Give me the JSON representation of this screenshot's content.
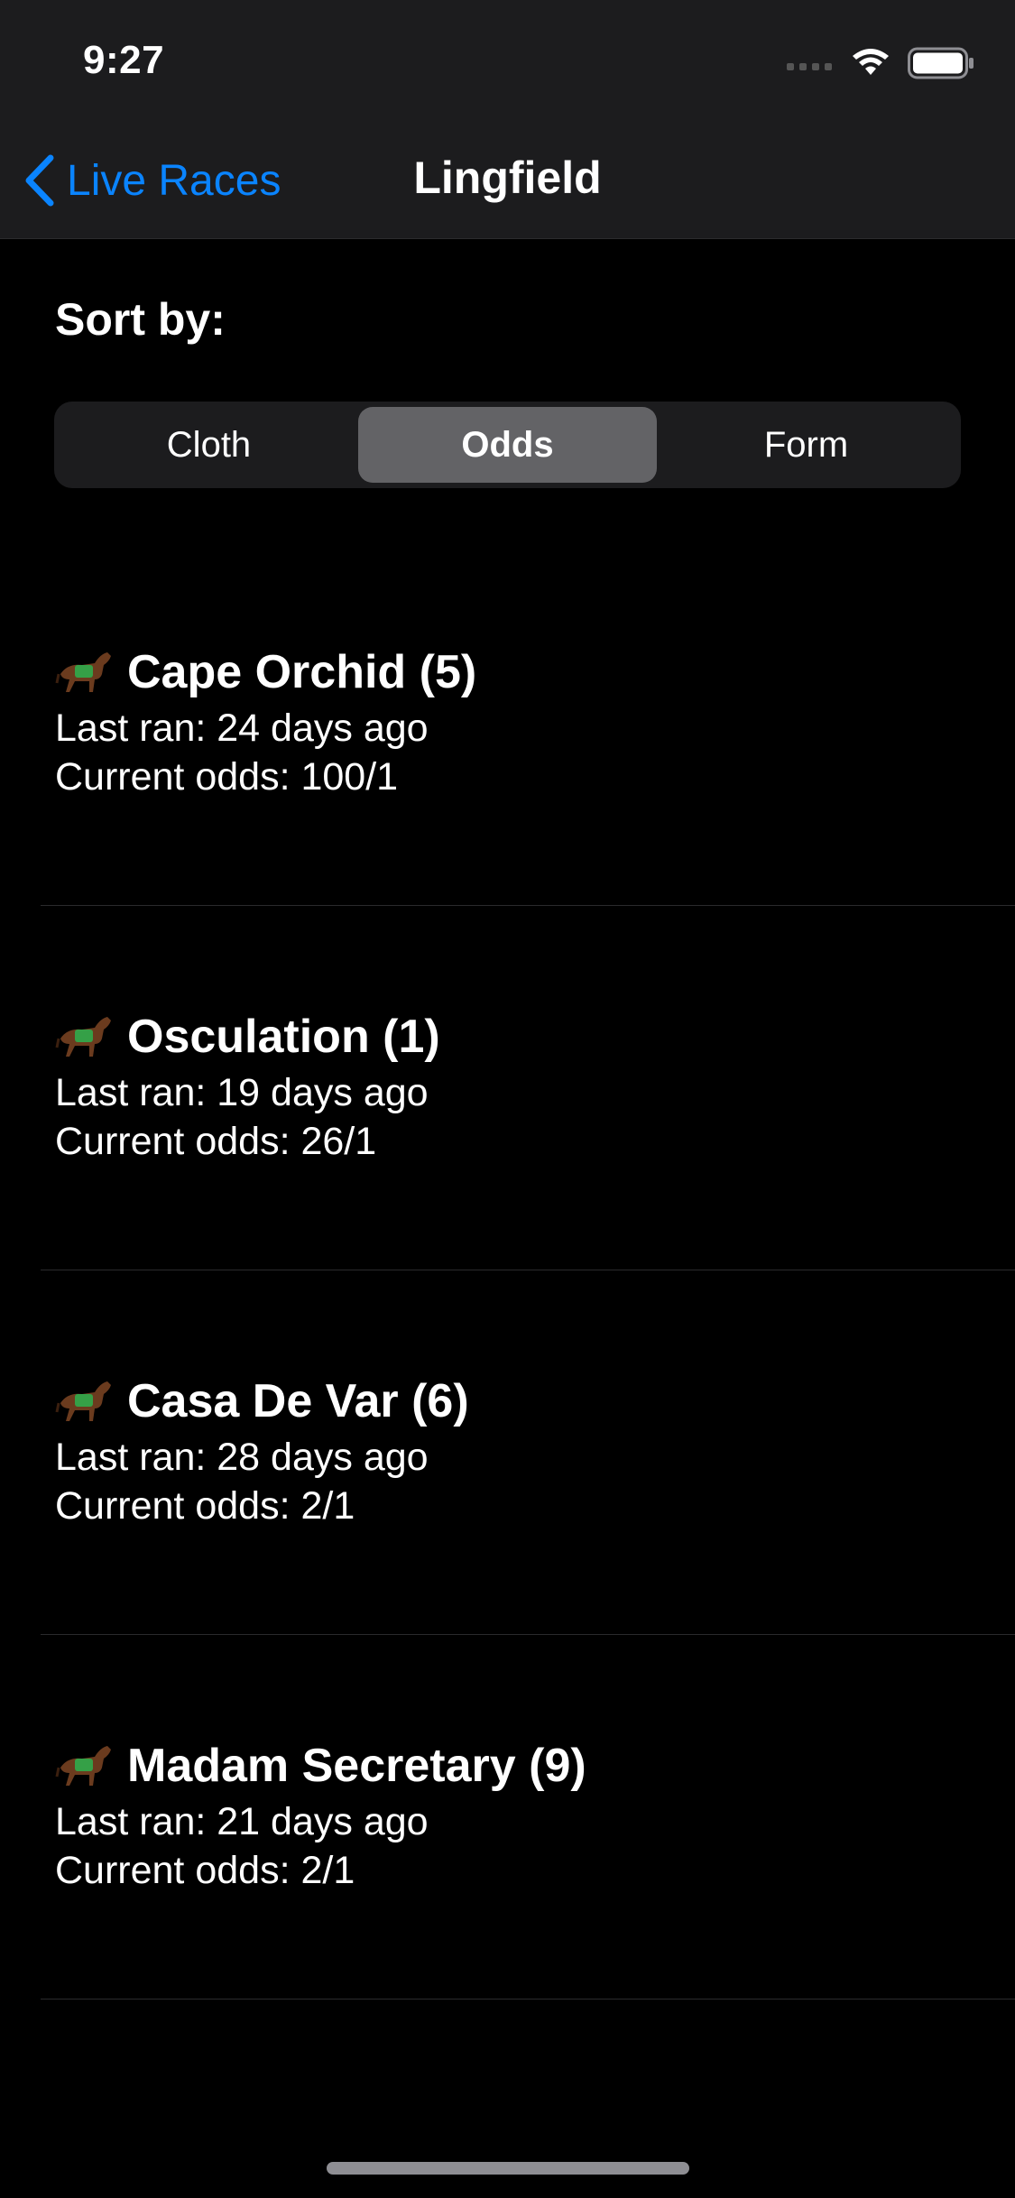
{
  "status_bar": {
    "time": "9:27"
  },
  "nav": {
    "back_label": "Live Races",
    "title": "Lingfield"
  },
  "sort": {
    "label": "Sort by:",
    "options": [
      "Cloth",
      "Odds",
      "Form"
    ],
    "selected": "Odds"
  },
  "runners": [
    {
      "name": "Cape Orchid (5)",
      "last_ran": "Last ran: 24 days ago",
      "odds": "Current odds: 100/1"
    },
    {
      "name": "Osculation (1)",
      "last_ran": "Last ran: 19 days ago",
      "odds": "Current odds: 26/1"
    },
    {
      "name": "Casa De Var (6)",
      "last_ran": "Last ran: 28 days ago",
      "odds": "Current odds: 2/1"
    },
    {
      "name": "Madam Secretary (9)",
      "last_ran": "Last ran: 21 days ago",
      "odds": "Current odds: 2/1"
    }
  ],
  "colors": {
    "accent": "#0a84ff",
    "background": "#000000",
    "bar": "#1c1c1e",
    "segment_selected": "#636366"
  },
  "icons": {
    "back": "chevron-left-icon",
    "runner": "horse-icon"
  }
}
